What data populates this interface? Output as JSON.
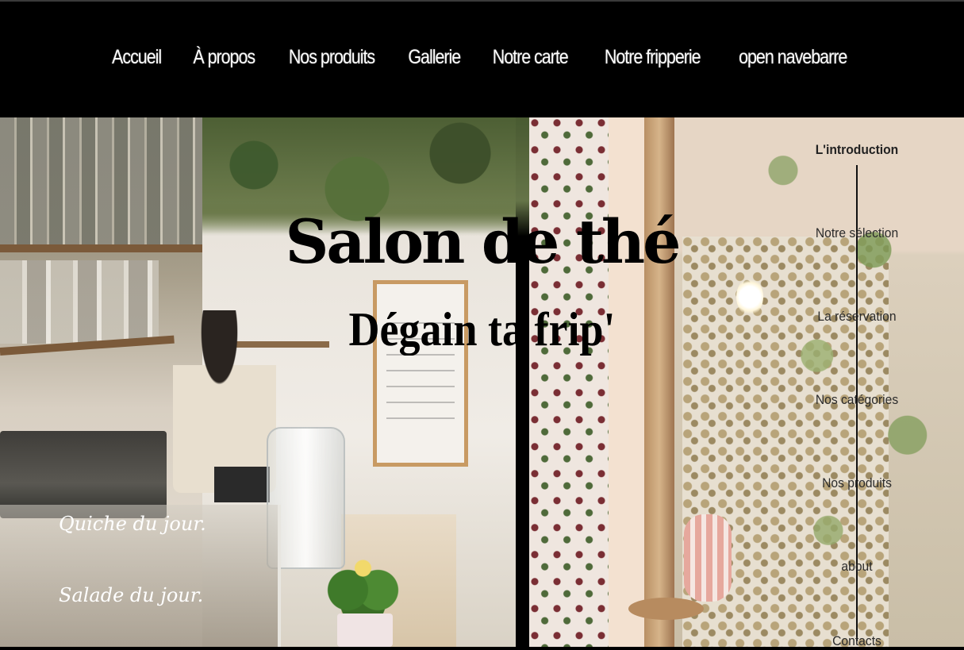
{
  "topnav": {
    "items": [
      "Accueil",
      "À propos",
      "Nos produits",
      "Gallerie",
      "Notre carte",
      "Notre fripperie",
      "open navebarre"
    ]
  },
  "hero": {
    "title": "Salon de thé",
    "subtitle": "Dégain ta frip'"
  },
  "photo_text": {
    "line1": "Quiche du jour.",
    "line2": "Salade du jour."
  },
  "sidenav": {
    "items": [
      "L'introduction",
      "Notre sélection",
      "La réservation",
      "Nos catégories",
      "Nos produits",
      "about",
      "Contacts"
    ],
    "active_index": 0
  }
}
